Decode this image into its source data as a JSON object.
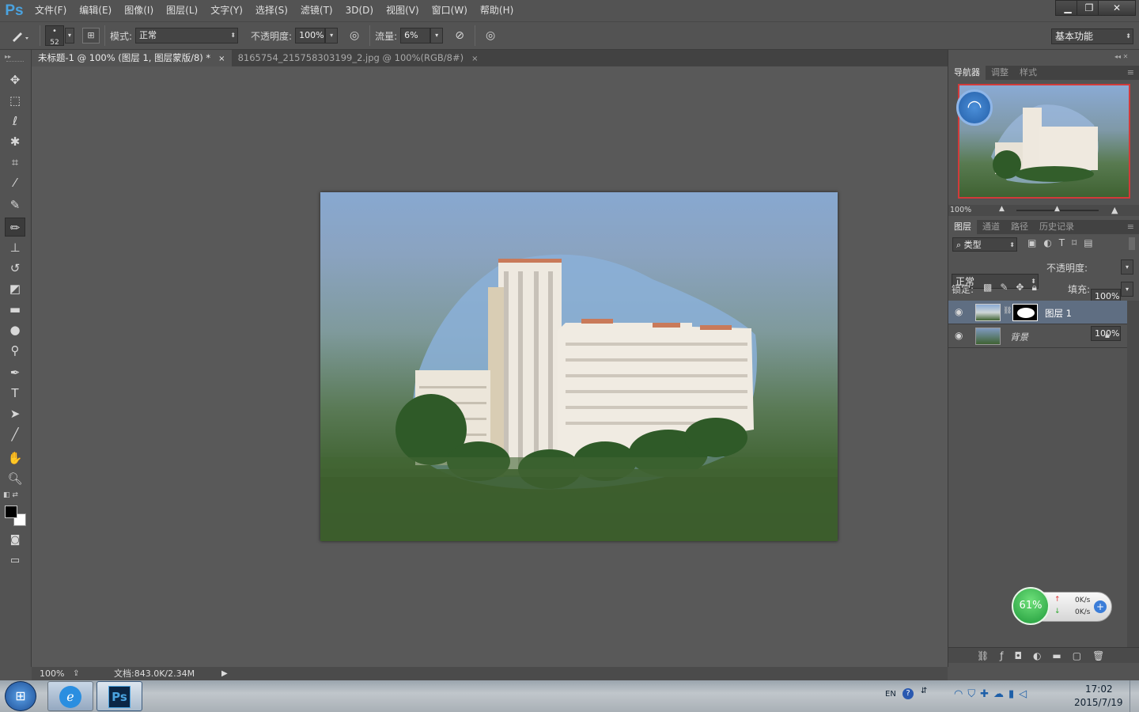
{
  "app": {
    "logo": "Ps"
  },
  "menu": [
    "文件(F)",
    "编辑(E)",
    "图像(I)",
    "图层(L)",
    "文字(Y)",
    "选择(S)",
    "滤镜(T)",
    "3D(D)",
    "视图(V)",
    "窗口(W)",
    "帮助(H)"
  ],
  "window_controls": {
    "minimize": "▁",
    "restore": "❐",
    "close": "✕"
  },
  "options": {
    "brush_size": "52",
    "mode_label": "模式:",
    "mode_value": "正常",
    "opacity_label": "不透明度:",
    "opacity_value": "100%",
    "flow_label": "流量:",
    "flow_value": "6%",
    "workspace": "基本功能"
  },
  "tabs": [
    {
      "label": "未标题-1 @ 100% (图层 1, 图层蒙版/8) *",
      "close": "×"
    },
    {
      "label": "8165754_215758303199_2.jpg @ 100%(RGB/8#)",
      "close": "×"
    }
  ],
  "status": {
    "zoom": "100%",
    "doc": "文档:843.0K/2.34M"
  },
  "navigator": {
    "tabs": [
      "导航器",
      "调整",
      "样式"
    ],
    "zoom": "100%"
  },
  "layers_panel": {
    "tabs": [
      "图层",
      "通道",
      "路径",
      "历史记录"
    ],
    "filter_label": "类型",
    "blend_mode": "正常",
    "opacity_label": "不透明度:",
    "opacity_value": "100%",
    "lock_label": "锁定:",
    "fill_label": "填充:",
    "fill_value": "100%",
    "layers": [
      {
        "name": "图层 1"
      },
      {
        "name": "背景"
      }
    ]
  },
  "net_widget": {
    "percent": "61%",
    "up": "0K/s",
    "down": "0K/s"
  },
  "taskbar": {
    "lang": "EN",
    "time": "17:02",
    "date": "2015/7/19"
  },
  "colors": {
    "accent": "#4aa3e0",
    "nav_frame": "#d23a3a",
    "selected_layer": "#5f6e82"
  },
  "icons": [
    "brush-icon",
    "move-icon",
    "marquee-icon",
    "lasso-icon",
    "magic-wand-icon",
    "crop-icon",
    "eyedropper-icon",
    "healing-icon",
    "stamp-icon",
    "history-brush-icon",
    "eraser-icon",
    "gradient-icon",
    "blur-icon",
    "dodge-icon",
    "pen-icon",
    "type-icon",
    "path-select-icon",
    "line-icon",
    "hand-icon",
    "zoom-icon",
    "eye-icon",
    "lock-icon",
    "wifi-icon"
  ]
}
